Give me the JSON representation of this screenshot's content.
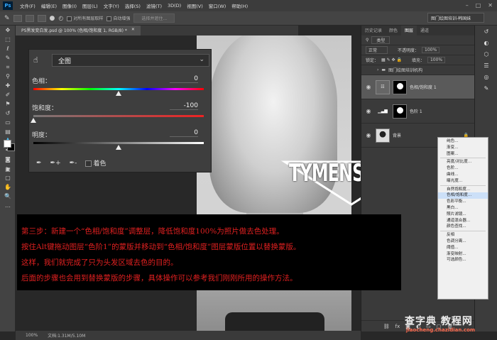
{
  "app": {
    "logo": "Ps"
  },
  "menubar": {
    "items": [
      "文件(F)",
      "编辑(E)",
      "图像(I)",
      "图层(L)",
      "文字(Y)",
      "选择(S)",
      "滤镜(T)",
      "3D(D)",
      "视图(V)",
      "窗口(W)",
      "帮助(H)"
    ]
  },
  "options": {
    "sample_all_layers": "对所有图层取样",
    "auto_enhance": "自动增强",
    "refine_edge": "选择并遮住...",
    "workspace": "图门绘图培训-韩国妹"
  },
  "document": {
    "tab_title": "PS黑发变白发.psd @ 100% (色相/饱和度 1, RGB/8) *",
    "zoom": "100%",
    "doc_size": "文档:1.31M/5.10M"
  },
  "properties": {
    "preset": "全图",
    "hue_label": "色相：",
    "hue_value": "0",
    "sat_label": "饱和度：",
    "sat_value": "-100",
    "light_label": "明度：",
    "light_value": "0",
    "colorize_label": "着色",
    "hue_pos": 0.5,
    "sat_pos": 0.0,
    "light_pos": 0.5
  },
  "panels": {
    "tabs_top": [
      "历史记录",
      "颜色",
      "图层",
      "通道"
    ],
    "kind_label": "类型",
    "blend_mode": "正常",
    "opacity_label": "不透明度：",
    "opacity_value": "100%",
    "lock_label": "锁定：",
    "fill_label": "填充：",
    "fill_value": "100%",
    "layers": [
      {
        "name": "图门绘图培训机构"
      },
      {
        "name": "色相/饱和度 1"
      },
      {
        "name": "色阶 1"
      },
      {
        "name": "背景"
      }
    ]
  },
  "context_menu": {
    "items": [
      "纯色...",
      "渐变...",
      "图案...",
      "-",
      "亮度/对比度...",
      "色阶...",
      "曲线...",
      "曝光度...",
      "-",
      "自然饱和度...",
      "色相/饱和度...",
      "色彩平衡...",
      "黑白...",
      "照片滤镜...",
      "通道混合器...",
      "颜色查找...",
      "-",
      "反相",
      "色调分离...",
      "阈值...",
      "渐变映射...",
      "可选颜色..."
    ],
    "highlight": "色相/饱和度..."
  },
  "logo_text": "TYMENSTUDIO",
  "overlay": {
    "lines": [
      "第三步：新建一个“色相/饱和度”调整层，降低饱和度100%为照片做去色处理。",
      "按住Alt键拖动图层“色阶1”的蒙版并移动到“色相/饱和度”图层蒙版位置以替换蒙版。",
      "这样，我们就完成了只为头发区域去色的目的。",
      "后面的步骤也会用到替换蒙版的步骤，具体操作可以参考我们刚刚所用的操作方法。"
    ]
  },
  "watermark": {
    "big": "查字典 教程网",
    "url": "jiaocheng.chazidian.com"
  }
}
